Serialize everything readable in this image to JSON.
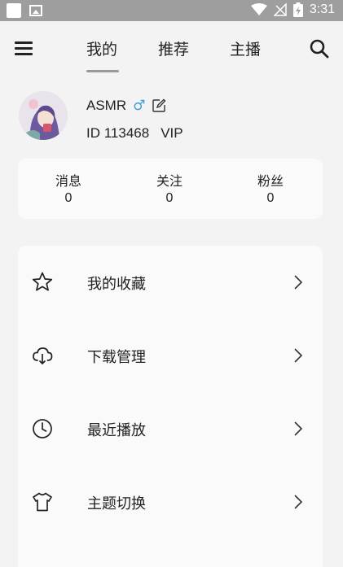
{
  "status_bar": {
    "time": "3:31"
  },
  "header": {
    "tabs": [
      {
        "label": "我的"
      },
      {
        "label": "推荐"
      },
      {
        "label": "主播"
      }
    ]
  },
  "profile": {
    "username": "ASMR",
    "gender_symbol": "♂",
    "id_text": "ID 113468",
    "vip_text": "VIP"
  },
  "stats": [
    {
      "label": "消息",
      "value": "0"
    },
    {
      "label": "关注",
      "value": "0"
    },
    {
      "label": "粉丝",
      "value": "0"
    }
  ],
  "menu": [
    {
      "label": "我的收藏",
      "icon": "star-icon"
    },
    {
      "label": "下载管理",
      "icon": "cloud-download-icon"
    },
    {
      "label": "最近播放",
      "icon": "clock-icon"
    },
    {
      "label": "主题切换",
      "icon": "tshirt-icon"
    }
  ],
  "colors": {
    "gender": "#3aa0e0",
    "status_bar": "#9e9e9e"
  }
}
